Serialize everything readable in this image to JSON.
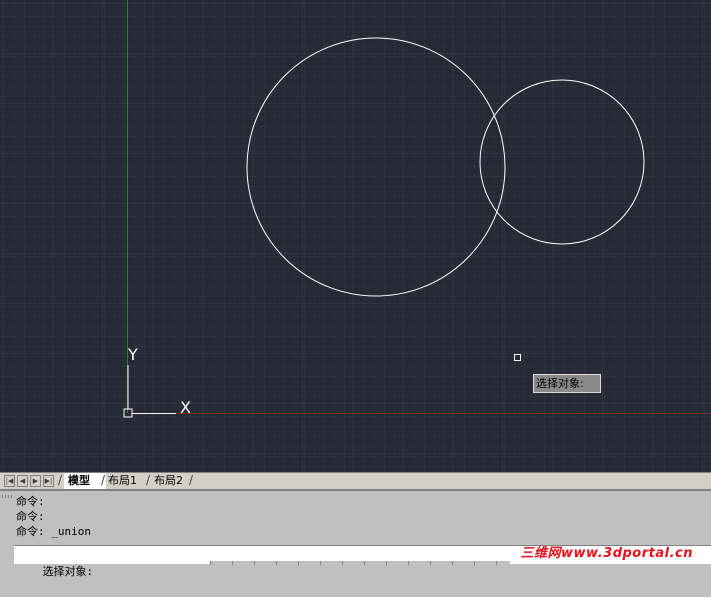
{
  "viewport": {
    "background": "#252a35",
    "grid_minor": "#2e3440",
    "grid_major": "#353c49",
    "y_axis_color": "#2e8b3a",
    "x_axis_color": "#8b2a2a",
    "entity_color": "#ffffff",
    "ucs": {
      "x_label": "X",
      "y_label": "Y"
    },
    "tooltip": "选择对象:"
  },
  "tabs": {
    "items": [
      {
        "label": "模型",
        "active": true
      },
      {
        "label": "布局1",
        "active": false
      },
      {
        "label": "布局2",
        "active": false
      }
    ]
  },
  "command": {
    "history": [
      "命令:",
      "命令:",
      "命令: _union"
    ],
    "prompt": "选择对象:"
  },
  "watermark": "三维网www.3dportal.cn"
}
